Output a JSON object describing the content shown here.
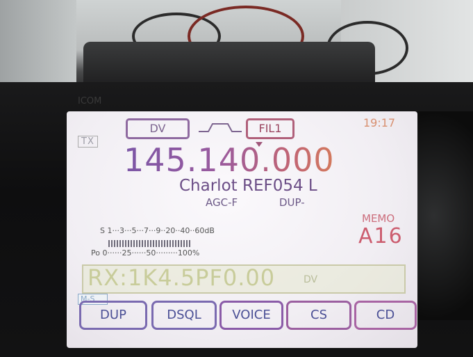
{
  "screen": {
    "tx_indicator": "TX",
    "mode": "DV",
    "filter": "FIL1",
    "clock": "19:17",
    "frequency": "145.140.000",
    "callsign_line": "Charlot REF054 L",
    "agc": "AGC-F",
    "duplex": "DUP-",
    "memo_label": "MEMO",
    "memo_channel": "A16",
    "s_meter_scale": "S 1···3···5···7···9··20··40··60dB",
    "po_scale": "Po 0······25······50·········100%",
    "rx_text": "RX:1K4.5PF0.00",
    "rx_mode": "DV",
    "ms_tab": "M-S",
    "softkeys": [
      "DUP",
      "DSQL",
      "VOICE",
      "CS",
      "CD"
    ]
  },
  "radio_brand": "ICOM"
}
